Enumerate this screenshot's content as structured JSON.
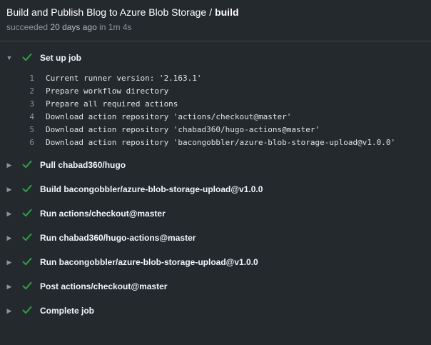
{
  "header": {
    "workflow": "Build and Publish Blog to Azure Blob Storage",
    "separator": "/",
    "job": "build",
    "status": "succeeded",
    "time_ago": "20 days ago",
    "duration_prefix": "in",
    "duration": "1m 4s"
  },
  "steps": [
    {
      "label": "Set up job",
      "expanded": true
    },
    {
      "label": "Pull chabad360/hugo",
      "expanded": false
    },
    {
      "label": "Build bacongobbler/azure-blob-storage-upload@v1.0.0",
      "expanded": false
    },
    {
      "label": "Run actions/checkout@master",
      "expanded": false
    },
    {
      "label": "Run chabad360/hugo-actions@master",
      "expanded": false
    },
    {
      "label": "Run bacongobbler/azure-blob-storage-upload@v1.0.0",
      "expanded": false
    },
    {
      "label": "Post actions/checkout@master",
      "expanded": false
    },
    {
      "label": "Complete job",
      "expanded": false
    }
  ],
  "setup_log": [
    {
      "n": "1",
      "text": "Current runner version: '2.163.1'"
    },
    {
      "n": "2",
      "text": "Prepare workflow directory"
    },
    {
      "n": "3",
      "text": "Prepare all required actions"
    },
    {
      "n": "4",
      "text": "Download action repository 'actions/checkout@master'"
    },
    {
      "n": "5",
      "text": "Download action repository 'chabad360/hugo-actions@master'"
    },
    {
      "n": "6",
      "text": "Download action repository 'bacongobbler/azure-blob-storage-upload@v1.0.0'"
    }
  ],
  "colors": {
    "success": "#2ea043",
    "caret": "#8b949e",
    "background": "#24292e"
  },
  "icons": {
    "expanded": "caret-down-icon",
    "collapsed": "caret-right-icon",
    "status": "check-icon"
  }
}
